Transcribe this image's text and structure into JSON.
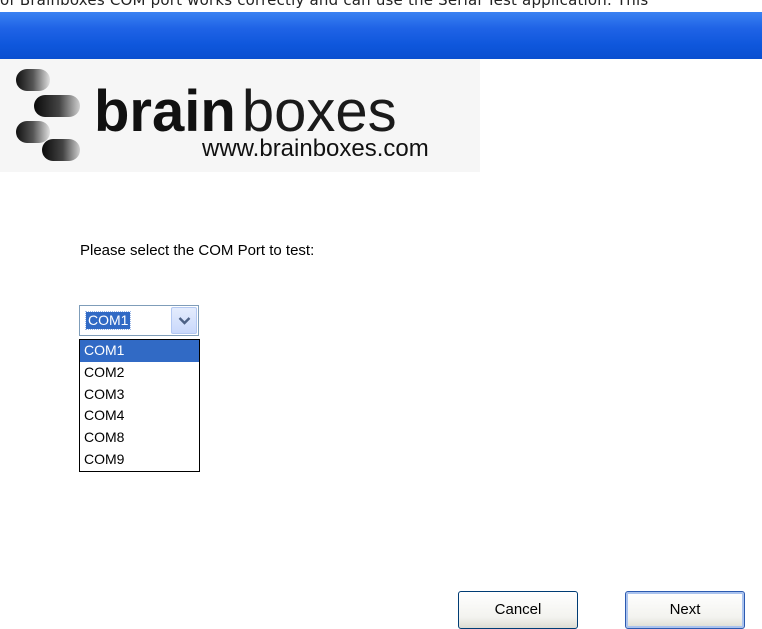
{
  "header": {
    "clipped_text": "of Brainboxes COM port works correctly and can use the Serial Test application. This"
  },
  "logo": {
    "brand_bold": "brain",
    "brand_light": "boxes",
    "url": "www.brainboxes.com"
  },
  "form": {
    "prompt": "Please select the COM Port to test:",
    "combo": {
      "selected": "COM1",
      "options": [
        "COM1",
        "COM2",
        "COM3",
        "COM4",
        "COM8",
        "COM9"
      ]
    }
  },
  "buttons": {
    "cancel": "Cancel",
    "next": "Next"
  },
  "colors": {
    "titlebar": "#0f57dc",
    "selection": "#316ac5"
  }
}
